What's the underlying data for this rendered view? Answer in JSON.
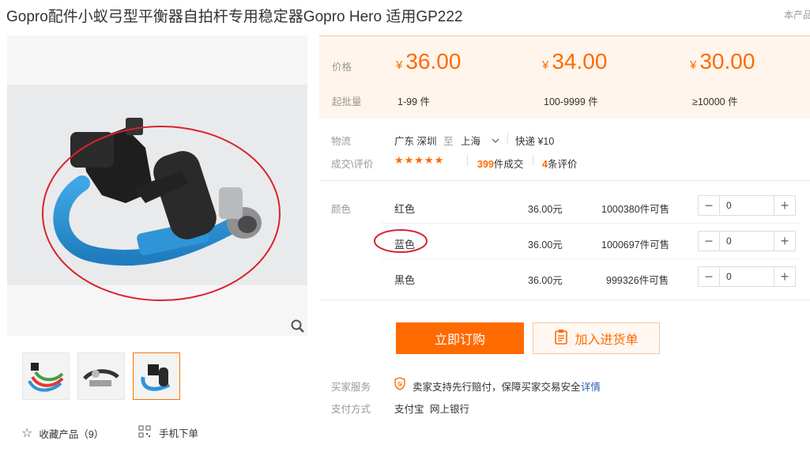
{
  "product": {
    "title": "Gopro配件小蚁弓型平衡器自拍杆专用稳定器Gopro Hero 适用GP222",
    "corner_text": "本产品"
  },
  "gallery": {
    "thumbnails": [
      "thumb-1",
      "thumb-2",
      "thumb-3"
    ],
    "selected_index": 2,
    "favorite_label": "收藏产品（9）",
    "mobile_label": "手机下单"
  },
  "pricing": {
    "price_label": "价格",
    "moq_label": "起批量",
    "currency": "¥",
    "tiers": [
      {
        "price": "36.00",
        "qty": "1-99 件"
      },
      {
        "price": "34.00",
        "qty": "100-9999 件"
      },
      {
        "price": "30.00",
        "qty": "≥10000 件"
      }
    ]
  },
  "logistics": {
    "label": "物流",
    "from": "广东 深圳",
    "to_word": "至",
    "to": "上海",
    "shipping": "快递 ¥10"
  },
  "deals": {
    "label": "成交\\评价",
    "stars": "★★★★★",
    "deal_count": "399",
    "deal_suffix": "件成交",
    "review_count": "4",
    "review_suffix": "条评价"
  },
  "sku": {
    "label": "颜色",
    "rows": [
      {
        "name": "红色",
        "price": "36.00元",
        "stock": "1000380件可售",
        "qty": "0"
      },
      {
        "name": "蓝色",
        "price": "36.00元",
        "stock": "1000697件可售",
        "qty": "0"
      },
      {
        "name": "黑色",
        "price": "36.00元",
        "stock": "999326件可售",
        "qty": "0"
      }
    ],
    "highlighted_index": 1
  },
  "actions": {
    "buy_now": "立即订购",
    "add_to_cart": "加入进货单"
  },
  "services": {
    "buyer_label": "买家服务",
    "buyer_text": "卖家支持先行赔付，保障买家交易安全",
    "buyer_link": "详情",
    "pay_label": "支付方式",
    "pay_methods": [
      "支付宝",
      "网上银行"
    ]
  },
  "colors": {
    "accent": "#ff6a00",
    "annotation": "#d9232d",
    "link": "#2a5db0"
  }
}
